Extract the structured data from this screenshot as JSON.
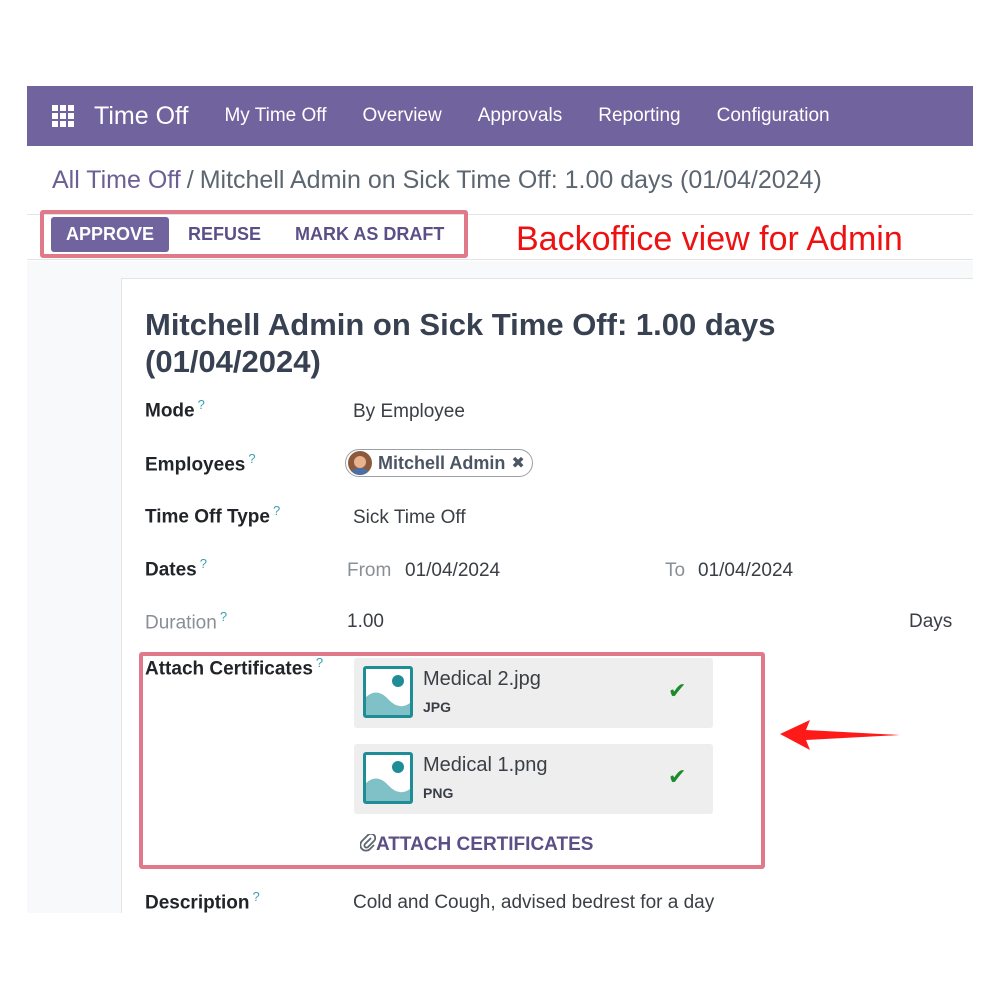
{
  "navbar": {
    "app_name": "Time Off",
    "menu": [
      "My Time Off",
      "Overview",
      "Approvals",
      "Reporting",
      "Configuration"
    ],
    "color": "#71639e"
  },
  "breadcrumb": {
    "parent": "All Time Off",
    "separator": "/",
    "current": "Mitchell Admin on Sick Time Off: 1.00 days (01/04/2024)"
  },
  "actions": {
    "approve": "APPROVE",
    "refuse": "REFUSE",
    "draft": "MARK AS DRAFT"
  },
  "annotation": {
    "text": "Backoffice view for Admin",
    "color": "#ee1111"
  },
  "form": {
    "title": "Mitchell Admin on Sick Time Off: 1.00 days (01/04/2024)",
    "mode": {
      "label": "Mode",
      "help": "?",
      "value": "By Employee"
    },
    "employees": {
      "label": "Employees",
      "help": "?",
      "tag": "Mitchell Admin",
      "remove": "✖"
    },
    "type": {
      "label": "Time Off Type",
      "help": "?",
      "value": "Sick Time Off"
    },
    "dates": {
      "label": "Dates",
      "help": "?",
      "from_label": "From",
      "from": "01/04/2024",
      "to_label": "To",
      "to": "01/04/2024"
    },
    "duration": {
      "label": "Duration",
      "help": "?",
      "value": "1.00",
      "unit": "Days"
    },
    "attachments": {
      "label": "Attach Certificates",
      "help": "?",
      "files": [
        {
          "name": "Medical 2.jpg",
          "ext": "JPG",
          "status_icon": "check-icon"
        },
        {
          "name": "Medical 1.png",
          "ext": "PNG",
          "status_icon": "check-icon"
        }
      ],
      "button": "ATTACH CERTIFICATES"
    },
    "description": {
      "label": "Description",
      "help": "?",
      "value": "Cold and Cough, advised bedrest for a day"
    }
  }
}
